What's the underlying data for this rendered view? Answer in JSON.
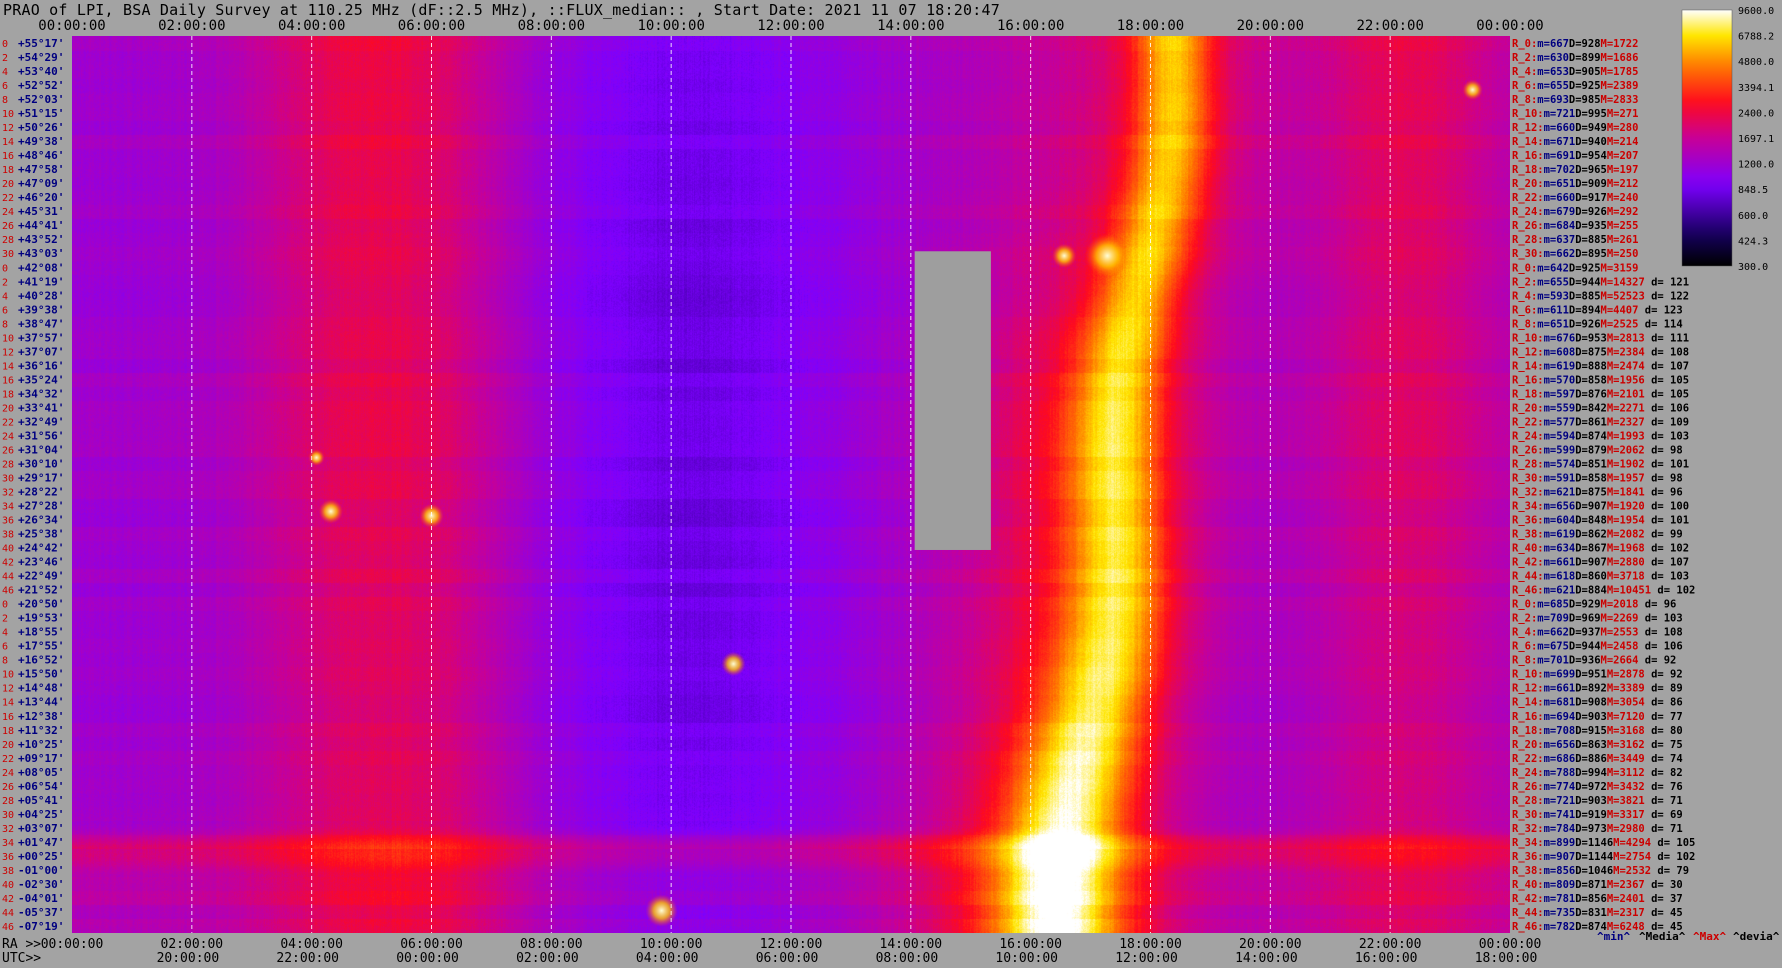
{
  "title": "PRAO of LPI, BSA Daily Survey at 110.25 MHz (dF::2.5 MHz), ::FLUX_median:: , Start Date: 2021 11 07 18:20:47",
  "colors": {
    "background": "#a3a3a3",
    "grid": "#ffffff",
    "label_red": "#cc0000",
    "label_blue": "#000080",
    "gap": "#9e9e9e"
  },
  "chart_data": {
    "type": "heatmap",
    "title": "PRAO of LPI, BSA Daily Survey at 110.25 MHz (dF::2.5 MHz), ::FLUX_median:: , Start Date: 2021 11 07 18:20:47",
    "x_axis_top": {
      "ticks": [
        "00:00:00",
        "02:00:00",
        "04:00:00",
        "06:00:00",
        "08:00:00",
        "10:00:00",
        "12:00:00",
        "14:00:00",
        "16:00:00",
        "18:00:00",
        "20:00:00",
        "22:00:00",
        "00:00:00"
      ]
    },
    "x_axis_bottom_ra": {
      "prefix": "RA >>",
      "ticks": [
        "00:00:00",
        "02:00:00",
        "04:00:00",
        "06:00:00",
        "08:00:00",
        "10:00:00",
        "12:00:00",
        "14:00:00",
        "16:00:00",
        "18:00:00",
        "20:00:00",
        "22:00:00",
        "00:00:00"
      ]
    },
    "x_axis_bottom_utc": {
      "prefix": "UTC>>",
      "ticks": [
        "20:00:00",
        "22:00:00",
        "00:00:00",
        "02:00:00",
        "04:00:00",
        "06:00:00",
        "08:00:00",
        "10:00:00",
        "12:00:00",
        "14:00:00",
        "16:00:00",
        "18:00:00"
      ]
    },
    "declinations": [
      "+55°17'",
      "+54°29'",
      "+53°40'",
      "+52°52'",
      "+52°03'",
      "+51°15'",
      "+50°26'",
      "+49°38'",
      "+48°46'",
      "+47°58'",
      "+47°09'",
      "+46°20'",
      "+45°31'",
      "+44°41'",
      "+43°52'",
      "+43°03'",
      "+42°08'",
      "+41°19'",
      "+40°28'",
      "+39°38'",
      "+38°47'",
      "+37°57'",
      "+37°07'",
      "+36°16'",
      "+35°24'",
      "+34°32'",
      "+33°41'",
      "+32°49'",
      "+31°56'",
      "+31°04'",
      "+30°10'",
      "+29°17'",
      "+28°22'",
      "+27°28'",
      "+26°34'",
      "+25°38'",
      "+24°42'",
      "+23°46'",
      "+22°49'",
      "+21°52'",
      "+20°50'",
      "+19°53'",
      "+18°55'",
      "+17°55'",
      "+16°52'",
      "+15°50'",
      "+14°48'",
      "+13°44'",
      "+12°38'",
      "+11°32'",
      "+10°25'",
      "+09°17'",
      "+08°05'",
      "+06°54'",
      "+05°41'",
      "+04°25'",
      "+03°07'",
      "+01°47'",
      "+00°25'",
      "-01°00'",
      "-02°30'",
      "-04°01'",
      "-05°37'",
      "-07°19'"
    ],
    "beam_numbers": [
      "0",
      "2",
      "4",
      "6",
      "8",
      "10",
      "12",
      "14",
      "16",
      "18",
      "20",
      "22",
      "24",
      "26",
      "28",
      "30",
      "0",
      "2",
      "4",
      "6",
      "8",
      "10",
      "12",
      "14",
      "16",
      "18",
      "20",
      "22",
      "24",
      "26",
      "28",
      "30",
      "32",
      "34",
      "36",
      "38",
      "40",
      "42",
      "44",
      "46",
      "0",
      "2",
      "4",
      "6",
      "8",
      "10",
      "12",
      "14",
      "16",
      "18",
      "20",
      "22",
      "24",
      "26",
      "28",
      "30",
      "32",
      "34",
      "36",
      "38",
      "40",
      "42",
      "44",
      "46"
    ],
    "beam_stats": [
      {
        "name": "R_0:",
        "min": "m=667",
        "median": "D=928",
        "max": "M=1722",
        "dev": ""
      },
      {
        "name": "R_2:",
        "min": "m=630",
        "median": "D=899",
        "max": "M=1686",
        "dev": ""
      },
      {
        "name": "R_4:",
        "min": "m=653",
        "median": "D=905",
        "max": "M=1785",
        "dev": ""
      },
      {
        "name": "R_6:",
        "min": "m=655",
        "median": "D=925",
        "max": "M=2389",
        "dev": ""
      },
      {
        "name": "R_8:",
        "min": "m=693",
        "median": "D=985",
        "max": "M=2833",
        "dev": ""
      },
      {
        "name": "R_10:",
        "min": "m=721",
        "median": "D=995",
        "max": "M=271",
        "dev": ""
      },
      {
        "name": "R_12:",
        "min": "m=660",
        "median": "D=949",
        "max": "M=280",
        "dev": ""
      },
      {
        "name": "R_14:",
        "min": "m=671",
        "median": "D=940",
        "max": "M=214",
        "dev": ""
      },
      {
        "name": "R_16:",
        "min": "m=691",
        "median": "D=954",
        "max": "M=207",
        "dev": ""
      },
      {
        "name": "R_18:",
        "min": "m=702",
        "median": "D=965",
        "max": "M=197",
        "dev": ""
      },
      {
        "name": "R_20:",
        "min": "m=651",
        "median": "D=909",
        "max": "M=212",
        "dev": ""
      },
      {
        "name": "R_22:",
        "min": "m=660",
        "median": "D=917",
        "max": "M=240",
        "dev": ""
      },
      {
        "name": "R_24:",
        "min": "m=679",
        "median": "D=926",
        "max": "M=292",
        "dev": ""
      },
      {
        "name": "R_26:",
        "min": "m=684",
        "median": "D=935",
        "max": "M=255",
        "dev": ""
      },
      {
        "name": "R_28:",
        "min": "m=637",
        "median": "D=885",
        "max": "M=261",
        "dev": ""
      },
      {
        "name": "R_30:",
        "min": "m=662",
        "median": "D=895",
        "max": "M=250",
        "dev": ""
      },
      {
        "name": "R_0:",
        "min": "m=642",
        "median": "D=925",
        "max": "M=3159",
        "dev": ""
      },
      {
        "name": "R_2:",
        "min": "m=655",
        "median": "D=944",
        "max": "M=14327",
        "dev": "d= 121"
      },
      {
        "name": "R_4:",
        "min": "m=593",
        "median": "D=885",
        "max": "M=52523",
        "dev": "d= 122"
      },
      {
        "name": "R_6:",
        "min": "m=611",
        "median": "D=894",
        "max": "M=4407",
        "dev": "d= 123"
      },
      {
        "name": "R_8:",
        "min": "m=651",
        "median": "D=926",
        "max": "M=2525",
        "dev": "d= 114"
      },
      {
        "name": "R_10:",
        "min": "m=676",
        "median": "D=953",
        "max": "M=2813",
        "dev": "d= 111"
      },
      {
        "name": "R_12:",
        "min": "m=608",
        "median": "D=875",
        "max": "M=2384",
        "dev": "d= 108"
      },
      {
        "name": "R_14:",
        "min": "m=619",
        "median": "D=888",
        "max": "M=2474",
        "dev": "d= 107"
      },
      {
        "name": "R_16:",
        "min": "m=570",
        "median": "D=858",
        "max": "M=1956",
        "dev": "d= 105"
      },
      {
        "name": "R_18:",
        "min": "m=597",
        "median": "D=876",
        "max": "M=2101",
        "dev": "d= 105"
      },
      {
        "name": "R_20:",
        "min": "m=559",
        "median": "D=842",
        "max": "M=2271",
        "dev": "d= 106"
      },
      {
        "name": "R_22:",
        "min": "m=577",
        "median": "D=861",
        "max": "M=2327",
        "dev": "d= 109"
      },
      {
        "name": "R_24:",
        "min": "m=594",
        "median": "D=874",
        "max": "M=1993",
        "dev": "d= 103"
      },
      {
        "name": "R_26:",
        "min": "m=599",
        "median": "D=879",
        "max": "M=2062",
        "dev": "d= 98"
      },
      {
        "name": "R_28:",
        "min": "m=574",
        "median": "D=851",
        "max": "M=1902",
        "dev": "d= 101"
      },
      {
        "name": "R_30:",
        "min": "m=591",
        "median": "D=858",
        "max": "M=1957",
        "dev": "d= 98"
      },
      {
        "name": "R_32:",
        "min": "m=621",
        "median": "D=875",
        "max": "M=1841",
        "dev": "d= 96"
      },
      {
        "name": "R_34:",
        "min": "m=656",
        "median": "D=907",
        "max": "M=1920",
        "dev": "d= 100"
      },
      {
        "name": "R_36:",
        "min": "m=604",
        "median": "D=848",
        "max": "M=1954",
        "dev": "d= 101"
      },
      {
        "name": "R_38:",
        "min": "m=619",
        "median": "D=862",
        "max": "M=2082",
        "dev": "d= 99"
      },
      {
        "name": "R_40:",
        "min": "m=634",
        "median": "D=867",
        "max": "M=1968",
        "dev": "d= 102"
      },
      {
        "name": "R_42:",
        "min": "m=661",
        "median": "D=907",
        "max": "M=2880",
        "dev": "d= 107"
      },
      {
        "name": "R_44:",
        "min": "m=618",
        "median": "D=860",
        "max": "M=3718",
        "dev": "d= 103"
      },
      {
        "name": "R_46:",
        "min": "m=621",
        "median": "D=884",
        "max": "M=10451",
        "dev": "d= 102"
      },
      {
        "name": "R_0:",
        "min": "m=685",
        "median": "D=929",
        "max": "M=2018",
        "dev": "d= 96"
      },
      {
        "name": "R_2:",
        "min": "m=709",
        "median": "D=969",
        "max": "M=2269",
        "dev": "d= 103"
      },
      {
        "name": "R_4:",
        "min": "m=662",
        "median": "D=937",
        "max": "M=2553",
        "dev": "d= 108"
      },
      {
        "name": "R_6:",
        "min": "m=675",
        "median": "D=944",
        "max": "M=2458",
        "dev": "d= 106"
      },
      {
        "name": "R_8:",
        "min": "m=701",
        "median": "D=936",
        "max": "M=2664",
        "dev": "d= 92"
      },
      {
        "name": "R_10:",
        "min": "m=699",
        "median": "D=951",
        "max": "M=2878",
        "dev": "d= 92"
      },
      {
        "name": "R_12:",
        "min": "m=661",
        "median": "D=892",
        "max": "M=3389",
        "dev": "d= 89"
      },
      {
        "name": "R_14:",
        "min": "m=681",
        "median": "D=908",
        "max": "M=3054",
        "dev": "d= 86"
      },
      {
        "name": "R_16:",
        "min": "m=694",
        "median": "D=903",
        "max": "M=7120",
        "dev": "d= 77"
      },
      {
        "name": "R_18:",
        "min": "m=708",
        "median": "D=915",
        "max": "M=3168",
        "dev": "d= 80"
      },
      {
        "name": "R_20:",
        "min": "m=656",
        "median": "D=863",
        "max": "M=3162",
        "dev": "d= 75"
      },
      {
        "name": "R_22:",
        "min": "m=686",
        "median": "D=886",
        "max": "M=3449",
        "dev": "d= 74"
      },
      {
        "name": "R_24:",
        "min": "m=788",
        "median": "D=994",
        "max": "M=3112",
        "dev": "d= 82"
      },
      {
        "name": "R_26:",
        "min": "m=774",
        "median": "D=972",
        "max": "M=3432",
        "dev": "d= 76"
      },
      {
        "name": "R_28:",
        "min": "m=721",
        "median": "D=903",
        "max": "M=3821",
        "dev": "d= 71"
      },
      {
        "name": "R_30:",
        "min": "m=741",
        "median": "D=919",
        "max": "M=3317",
        "dev": "d= 69"
      },
      {
        "name": "R_32:",
        "min": "m=784",
        "median": "D=973",
        "max": "M=2980",
        "dev": "d= 71"
      },
      {
        "name": "R_34:",
        "min": "m=899",
        "median": "D=1146",
        "max": "M=4294",
        "dev": "d= 105"
      },
      {
        "name": "R_36:",
        "min": "m=907",
        "median": "D=1144",
        "max": "M=2754",
        "dev": "d= 102"
      },
      {
        "name": "R_38:",
        "min": "m=856",
        "median": "D=1046",
        "max": "M=2532",
        "dev": "d= 79"
      },
      {
        "name": "R_40:",
        "min": "m=809",
        "median": "D=871",
        "max": "M=2367",
        "dev": "d= 30"
      },
      {
        "name": "R_42:",
        "min": "m=781",
        "median": "D=856",
        "max": "M=2401",
        "dev": "d= 37"
      },
      {
        "name": "R_44:",
        "min": "m=735",
        "median": "D=831",
        "max": "M=2317",
        "dev": "d= 45"
      },
      {
        "name": "R_46:",
        "min": "m=782",
        "median": "D=874",
        "max": "M=6248",
        "dev": "d= 45"
      }
    ],
    "stats_legend": [
      "^min^",
      "^Media^",
      "^Max^",
      "^devia^"
    ],
    "colorbar": {
      "ticks": [
        "9600.0",
        "6788.2",
        "4800.0",
        "3394.1",
        "2400.0",
        "1697.1",
        "1200.0",
        "848.5",
        "600.0",
        "424.3",
        "300.0"
      ],
      "range": [
        300,
        9600
      ],
      "scale": "log"
    },
    "grid": true
  }
}
